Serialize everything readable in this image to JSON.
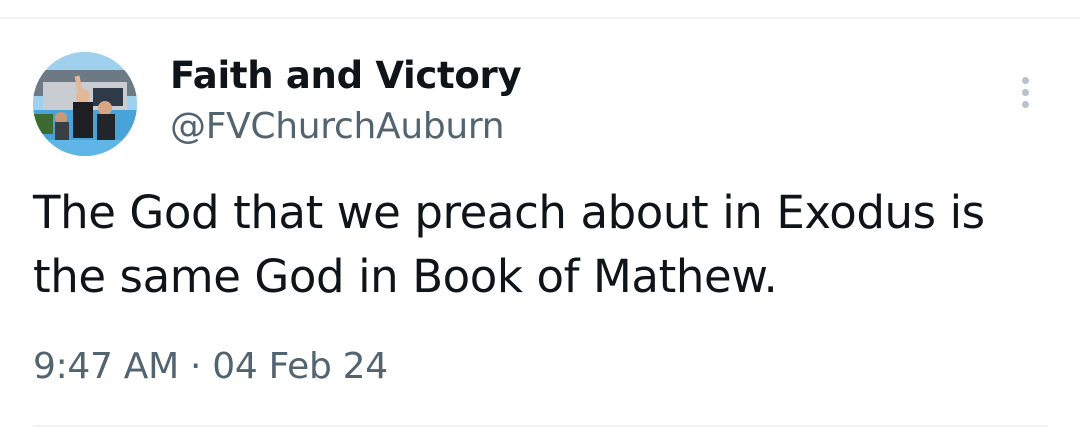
{
  "tweet": {
    "author_name": "Faith and Victory",
    "author_handle": "@FVChurchAuburn",
    "text_line_1": "The God that we preach about in Exodus is",
    "text_line_2": "the same God in Book of Mathew.",
    "timestamp": "9:47 AM · 04 Feb 24",
    "more_icon": "more-vertical-icon",
    "avatar_description": "profile-photo"
  },
  "colors": {
    "text_primary": "#0f1419",
    "text_secondary": "#536471",
    "divider": "#eff3f4",
    "more_icon": "#b8c2c9"
  }
}
